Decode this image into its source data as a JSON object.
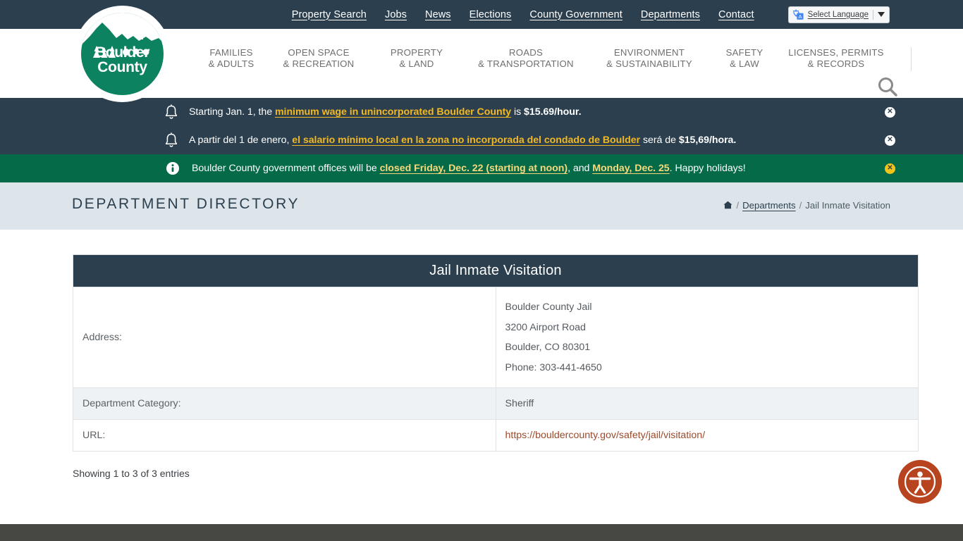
{
  "topbar": {
    "links": [
      {
        "label": "Property Search",
        "name": "toplink-property-search"
      },
      {
        "label": "Jobs",
        "name": "toplink-jobs"
      },
      {
        "label": "News",
        "name": "toplink-news"
      },
      {
        "label": "Elections",
        "name": "toplink-elections"
      },
      {
        "label": "County Government",
        "name": "toplink-county-government"
      },
      {
        "label": "Departments",
        "name": "toplink-departments"
      },
      {
        "label": "Contact",
        "name": "toplink-contact"
      }
    ],
    "translate_label": "Select Language"
  },
  "logo": {
    "line1": "Boulder",
    "line2": "County",
    "brand_color": "#0c8260"
  },
  "nav": {
    "items": [
      {
        "l1": "FAMILIES",
        "l2": "& ADULTS"
      },
      {
        "l1": "OPEN SPACE",
        "l2": "& RECREATION"
      },
      {
        "l1": "PROPERTY",
        "l2": "& LAND"
      },
      {
        "l1": "ROADS",
        "l2": "& TRANSPORTATION"
      },
      {
        "l1": "ENVIRONMENT",
        "l2": "& SUSTAINABILITY"
      },
      {
        "l1": "SAFETY",
        "l2": "& LAW"
      },
      {
        "l1": "LICENSES, PERMITS",
        "l2": "& RECORDS"
      }
    ]
  },
  "alerts": [
    {
      "icon": "bell-icon",
      "style": "dark",
      "pre": "Starting Jan. 1, the ",
      "link": "minimum wage in unincorporated Boulder County",
      "mid": " is ",
      "bold": "$15.69/hour.",
      "post": "",
      "close_color": "#ffffff"
    },
    {
      "icon": "bell-icon",
      "style": "dark",
      "pre": "A partir del 1 de enero, ",
      "link": "el salario mínimo local en la zona no incorporada del condado de Boulder",
      "mid": " será de ",
      "bold": "$15,69/hora.",
      "post": "",
      "close_color": "#ffffff"
    },
    {
      "icon": "info-icon",
      "style": "green",
      "pre": "Boulder County government offices will be ",
      "link": "closed Friday, Dec. 22 (starting at noon)",
      "mid": ", and ",
      "link2": "Monday, Dec. 25",
      "post": ". Happy holidays!",
      "close_color": "#f2c318"
    }
  ],
  "titlebar": {
    "title": "DEPARTMENT DIRECTORY",
    "breadcrumb": {
      "home_icon": "home-icon",
      "sep1": "/",
      "parent": "Departments",
      "sep2": "/",
      "current": "Jail Inmate Visitation"
    }
  },
  "table": {
    "caption": "Jail Inmate Visitation",
    "rows": [
      {
        "label": "Address:",
        "value_lines": [
          "Boulder County Jail",
          "3200 Airport Road",
          "Boulder, CO 80301",
          "Phone: 303-441-4650"
        ],
        "is_link": false,
        "alt": false
      },
      {
        "label": "Department Category:",
        "value_lines": [
          "Sheriff"
        ],
        "is_link": false,
        "alt": true
      },
      {
        "label": "URL:",
        "value_lines": [
          "https://bouldercounty.gov/safety/jail/visitation/"
        ],
        "is_link": true,
        "alt": false
      }
    ],
    "showing": "Showing 1 to 3 of 3 entries"
  },
  "accessibility": {
    "name": "accessibility-icon",
    "color": "#b8431f"
  },
  "colors": {
    "header_dark": "#2b3f4e",
    "alert_green": "#046a48",
    "alert_link": "#f2b824",
    "titlebar_bg": "#dde5ea",
    "table_alt_row": "#eef2f5",
    "cell_link": "#9c4a2a",
    "footer": "#474744"
  }
}
